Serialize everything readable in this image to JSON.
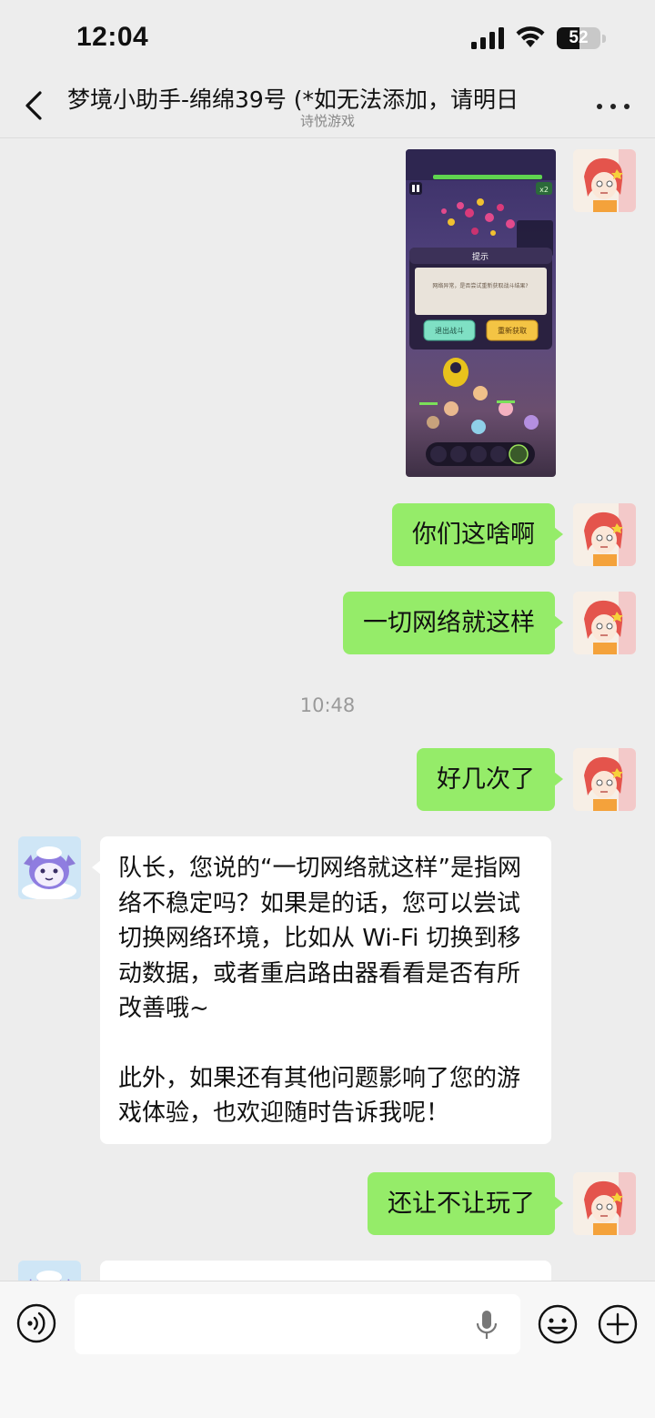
{
  "status_bar": {
    "time": "12:04",
    "battery_level": "52",
    "battery_fraction": 0.52
  },
  "nav": {
    "title": "梦境小助手-绵绵39号 (*如无法添加，请明日",
    "subtitle": "诗悦游戏"
  },
  "game_screenshot": {
    "dialog_title": "提示",
    "dialog_message": "网络异常，是否尝试重新获取战斗结果?",
    "exit_button": "退出战斗",
    "retry_button": "重新获取",
    "speed_badge": "x2"
  },
  "messages": [
    {
      "sender": "me",
      "type": "image"
    },
    {
      "sender": "me",
      "text": "你们这啥啊"
    },
    {
      "sender": "me",
      "text": "一切网络就这样"
    },
    {
      "sender": "system",
      "text": "10:48"
    },
    {
      "sender": "me",
      "text": "好几次了"
    },
    {
      "sender": "bot",
      "text_p1": "队长，您说的“一切网络就这样”是指网络不稳定吗？如果是的话，您可以尝试切换网络环境，比如从 Wi-Fi 切换到移动数据，或者重启路由器看看是否有所改善哦~",
      "text_p2": "此外，如果还有其他问题影响了您的游戏体验，也欢迎随时告诉我呢！"
    },
    {
      "sender": "me",
      "text": "还让不让玩了"
    }
  ],
  "input_bar": {
    "placeholder": ""
  },
  "colors": {
    "outgoing_bubble": "#95ec69",
    "incoming_bubble": "#ffffff",
    "background": "#ededed"
  },
  "icons": [
    "signal-icon",
    "wifi-icon",
    "battery-icon",
    "back-arrow-icon",
    "more-dots-icon",
    "voice-icon",
    "mic-icon",
    "emoji-icon",
    "plus-icon"
  ]
}
